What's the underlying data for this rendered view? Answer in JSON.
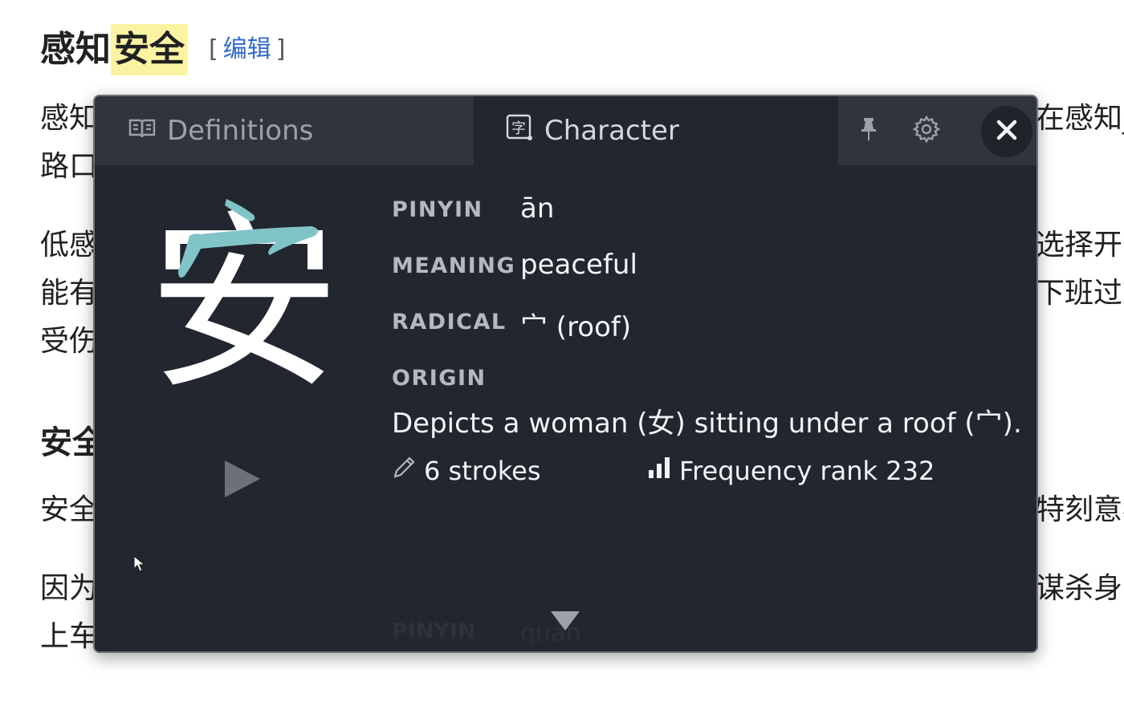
{
  "article": {
    "heading_prefix": "感知",
    "heading_highlight": "安全",
    "edit_open": "[",
    "edit_label": "编辑",
    "edit_close": "]",
    "paragraphs": [
      {
        "left_lines": [
          "感知",
          "路口"
        ],
        "right_lines": [
          "在感知_",
          ""
        ]
      },
      {
        "left_lines": [
          "低感",
          "能有",
          "受伤"
        ],
        "right_lines": [
          "选择开车",
          "下班过",
          ""
        ]
      },
      {
        "left_lines": [
          "安全"
        ],
        "right_lines": [
          "特刻意犯"
        ]
      },
      {
        "left_lines": [
          "因为",
          "上车"
        ],
        "right_lines": [
          "谋杀身",
          ""
        ]
      }
    ],
    "subheading": "安全"
  },
  "popup": {
    "tabs": {
      "definitions": "Definitions",
      "character": "Character"
    },
    "active_tab": "Character",
    "toolbar_icons": [
      "pin-icon",
      "gear-icon",
      "close-icon"
    ],
    "character": "安",
    "fields": {
      "pinyin_label": "PINYIN",
      "pinyin_value": "ān",
      "meaning_label": "MEANING",
      "meaning_value": "peaceful",
      "radical_label": "RADICAL",
      "radical_value": "宀 (roof)",
      "origin_label": "ORIGIN",
      "origin_value": "Depicts a woman (女) sitting under a roof (宀)."
    },
    "strokes": "6 strokes",
    "frequency": "Frequency rank 232",
    "next_entry": {
      "label": "PINYIN",
      "value": "quán"
    }
  },
  "colors": {
    "popup_bg": "#22262f",
    "tabbar_bg": "#2f343e",
    "accent_teal": "#80c4c8",
    "highlight": "#fbf3a2",
    "link": "#3366cc"
  }
}
